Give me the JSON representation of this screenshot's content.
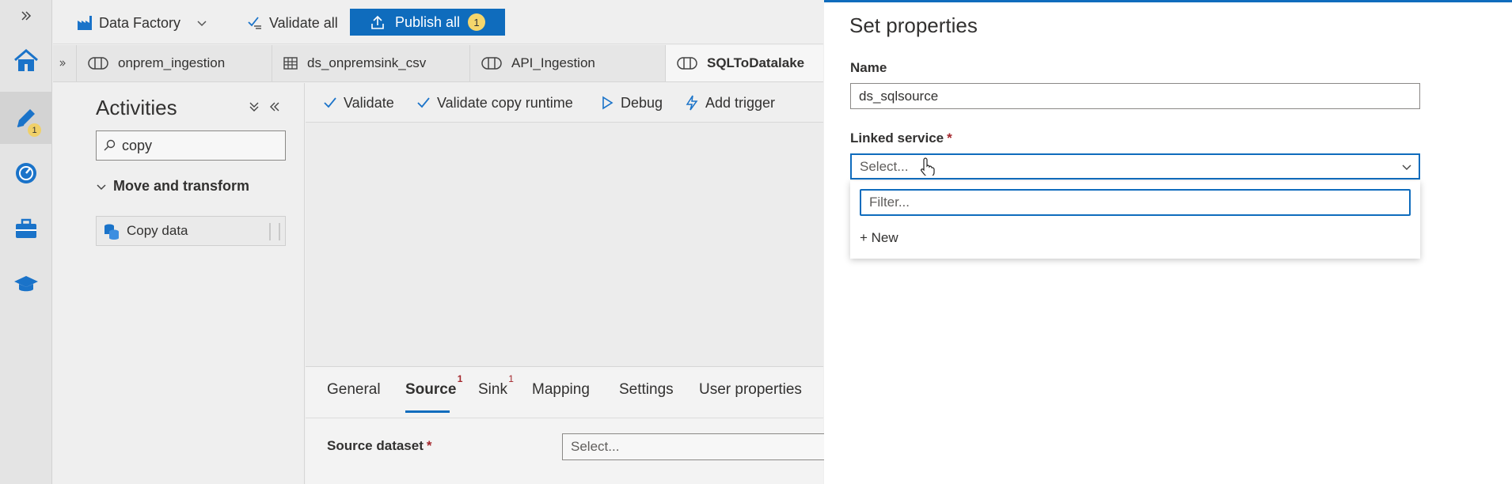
{
  "topbar": {
    "factory_label": "Data Factory",
    "validate_all_label": "Validate all",
    "publish_label": "Publish all",
    "publish_count": "1"
  },
  "rail": {
    "author_badge": "1"
  },
  "tabs": [
    {
      "label": "onprem_ingestion"
    },
    {
      "label": "ds_onpremsink_csv"
    },
    {
      "label": "API_Ingestion"
    },
    {
      "label": "SQLToDatalake"
    }
  ],
  "activities": {
    "title": "Activities",
    "search_value": "copy",
    "section": "Move and transform",
    "item": "Copy data"
  },
  "canvas_toolbar": {
    "validate": "Validate",
    "validate_copy_runtime": "Validate copy runtime",
    "debug": "Debug",
    "add_trigger": "Add trigger"
  },
  "bottom_panel": {
    "tabs": [
      {
        "label": "General"
      },
      {
        "label": "Source",
        "error": "1"
      },
      {
        "label": "Sink",
        "error": "1"
      },
      {
        "label": "Mapping"
      },
      {
        "label": "Settings"
      },
      {
        "label": "User properties"
      }
    ],
    "source_dataset_label": "Source dataset",
    "required_mark": "*",
    "source_dataset_placeholder": "Select..."
  },
  "properties": {
    "title": "Set properties",
    "name_label": "Name",
    "name_value": "ds_sqlsource",
    "linked_service_label": "Linked service",
    "required_mark": "*",
    "linked_service_placeholder": "Select...",
    "filter_placeholder": "Filter...",
    "new_option": "+ New"
  },
  "colors": {
    "accent": "#0f6cbd",
    "badge": "#f5d66c",
    "error": "#a4262c"
  }
}
